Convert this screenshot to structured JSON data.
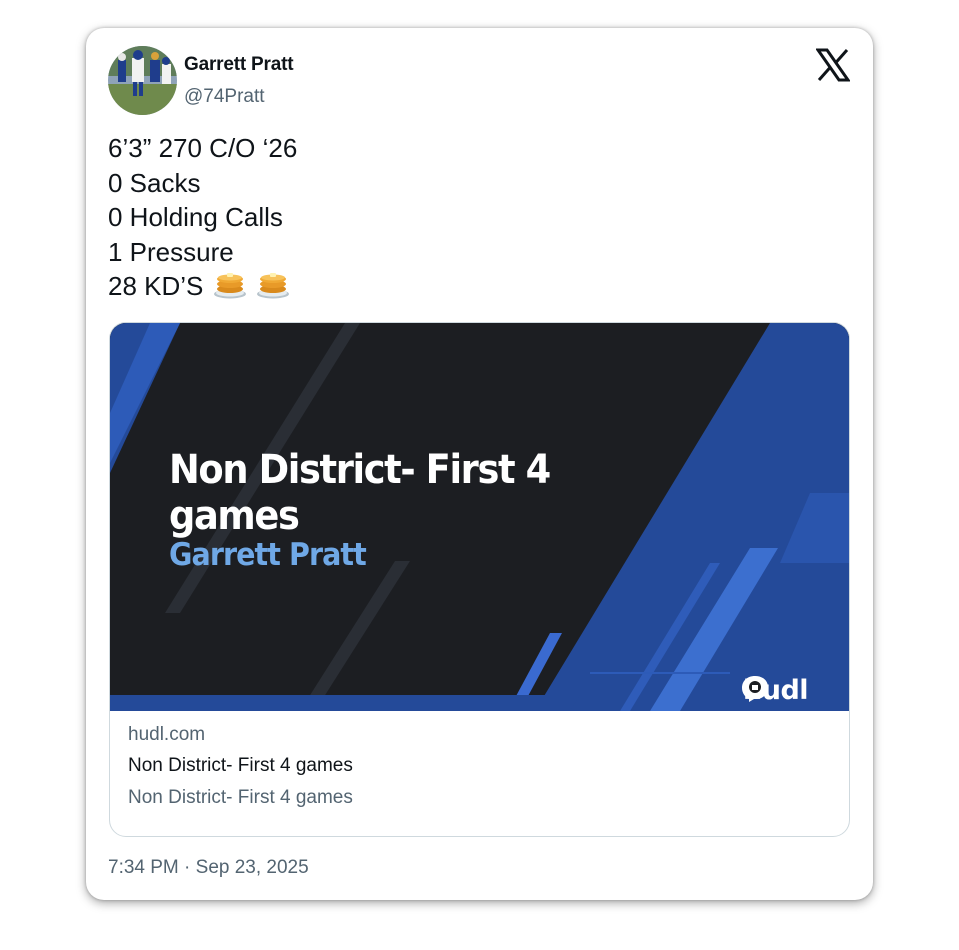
{
  "author": {
    "name": "Garrett Pratt",
    "handle": "@74Pratt",
    "avatar_icon": "profile-photo"
  },
  "brand_icon": "x-logo-icon",
  "tweet": {
    "lines": [
      "6’3” 270 C/O ‘26",
      "0 Sacks",
      "0 Holding Calls",
      "1 Pressure",
      "28 KD’S"
    ],
    "emoji": [
      "🥞",
      "🥞"
    ]
  },
  "link_card": {
    "preview": {
      "title": "Non District- First 4 games",
      "subtitle": "Garrett Pratt",
      "brand": "hudl",
      "colors": {
        "background": "#1c1e22",
        "accent": "#2b58b5",
        "subtitle": "#6fa8e6"
      }
    },
    "domain": "hudl.com",
    "title": "Non District- First 4 games",
    "description": "Non District- First 4 games"
  },
  "timestamp": "7:34 PM · Sep 23, 2025"
}
